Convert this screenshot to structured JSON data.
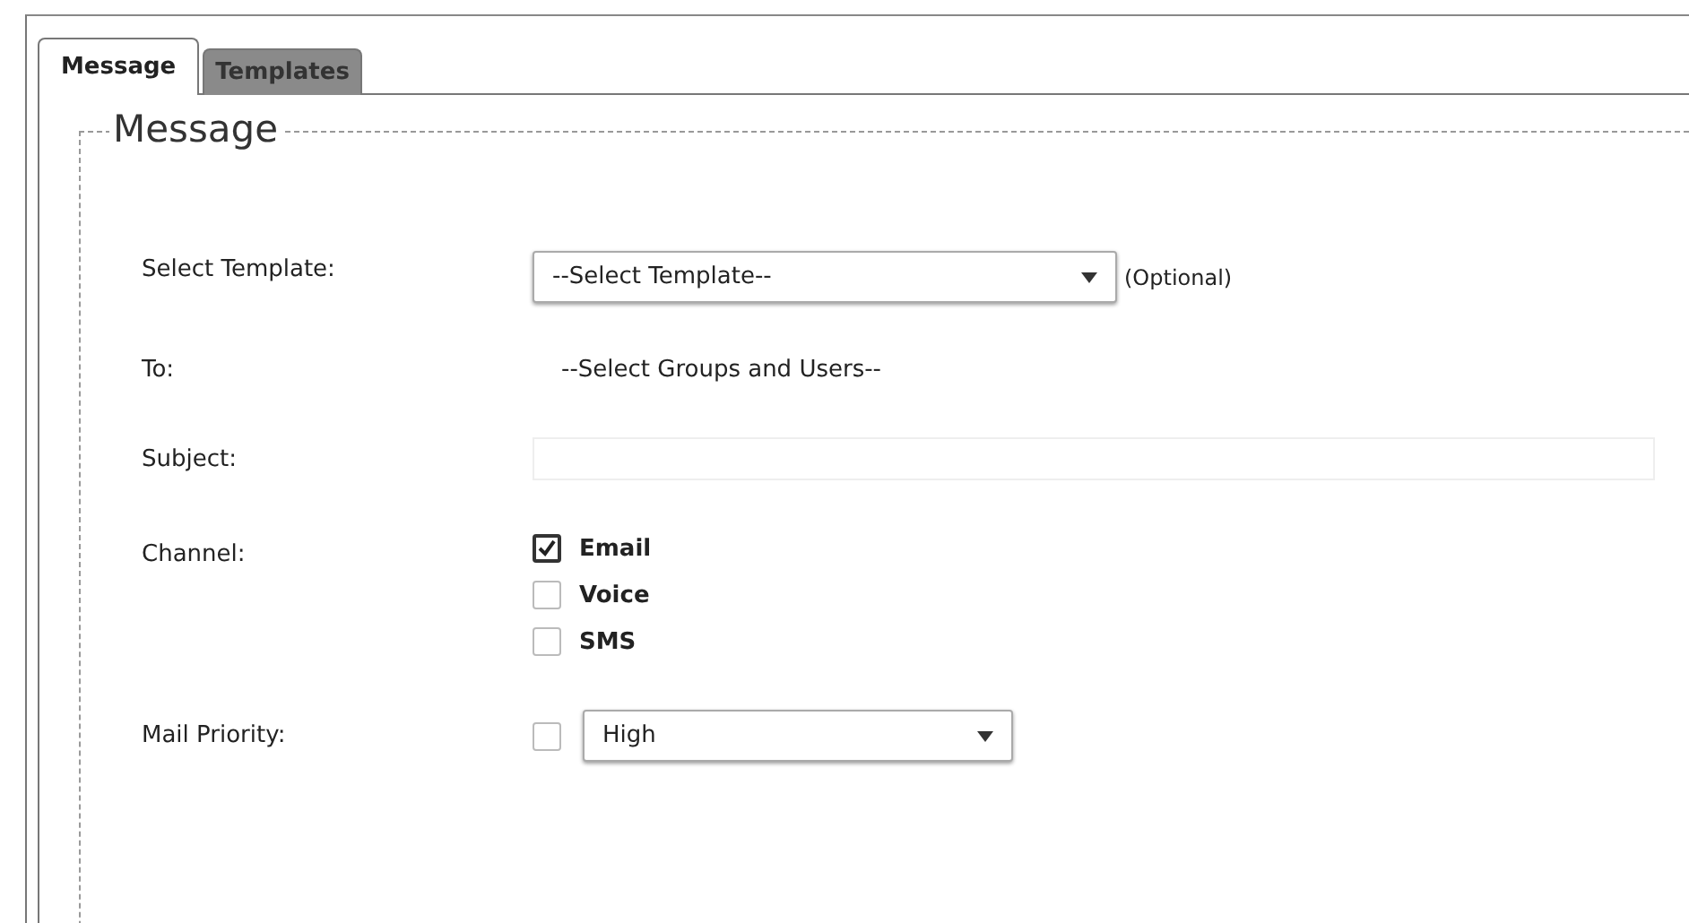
{
  "tabs": [
    {
      "label": "Message",
      "selected": true
    },
    {
      "label": "Templates",
      "selected": false
    }
  ],
  "fieldset": {
    "legend": "Message"
  },
  "template": {
    "label": "Select Template:",
    "value": "--Select Template--",
    "note": "(Optional)"
  },
  "to": {
    "label": "To:",
    "value": "--Select Groups and Users--"
  },
  "subject": {
    "label": "Subject:"
  },
  "channel": {
    "label": "Channel:",
    "options": [
      {
        "label": "Email",
        "checked": true
      },
      {
        "label": "Voice",
        "checked": false
      },
      {
        "label": "SMS",
        "checked": false
      }
    ]
  },
  "priority": {
    "label": "Mail Priority:",
    "checked": false,
    "value": "High"
  }
}
